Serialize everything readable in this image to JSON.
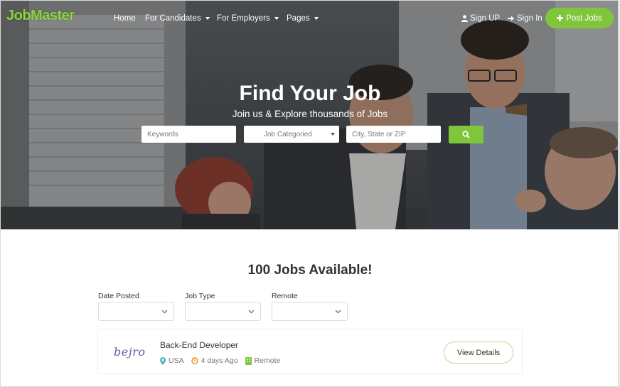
{
  "brand": {
    "logo": "JobMaster",
    "accent": "#7fc63c"
  },
  "nav": {
    "home": "Home",
    "candidates": "For Candidates",
    "employers": "For Employers",
    "pages": "Pages",
    "signup": "Sign UP",
    "signin": "Sign In",
    "post_jobs": "Post Jobs"
  },
  "hero": {
    "title": "Find Your Job",
    "subtitle": "Join us & Explore thousands of Jobs",
    "keywords_placeholder": "Keywords",
    "category_placeholder": "Job Categoried",
    "location_placeholder": "City, State or ZIP"
  },
  "jobs": {
    "count_title": "100 Jobs Available!",
    "filters": [
      {
        "label": "Date Posted",
        "value": ""
      },
      {
        "label": "Job Type",
        "value": ""
      },
      {
        "label": "Remote",
        "value": ""
      }
    ],
    "list": [
      {
        "company_logo_text": "bejro",
        "title": "Back-End Developer",
        "location": "USA",
        "posted": "4 days Ago",
        "type": "Remote",
        "action": "View Details"
      }
    ]
  },
  "icons": [
    "user-icon",
    "sign-in-icon",
    "plus-icon",
    "search-icon",
    "chevron-down-icon",
    "map-marker-icon",
    "clock-icon",
    "building-icon"
  ]
}
